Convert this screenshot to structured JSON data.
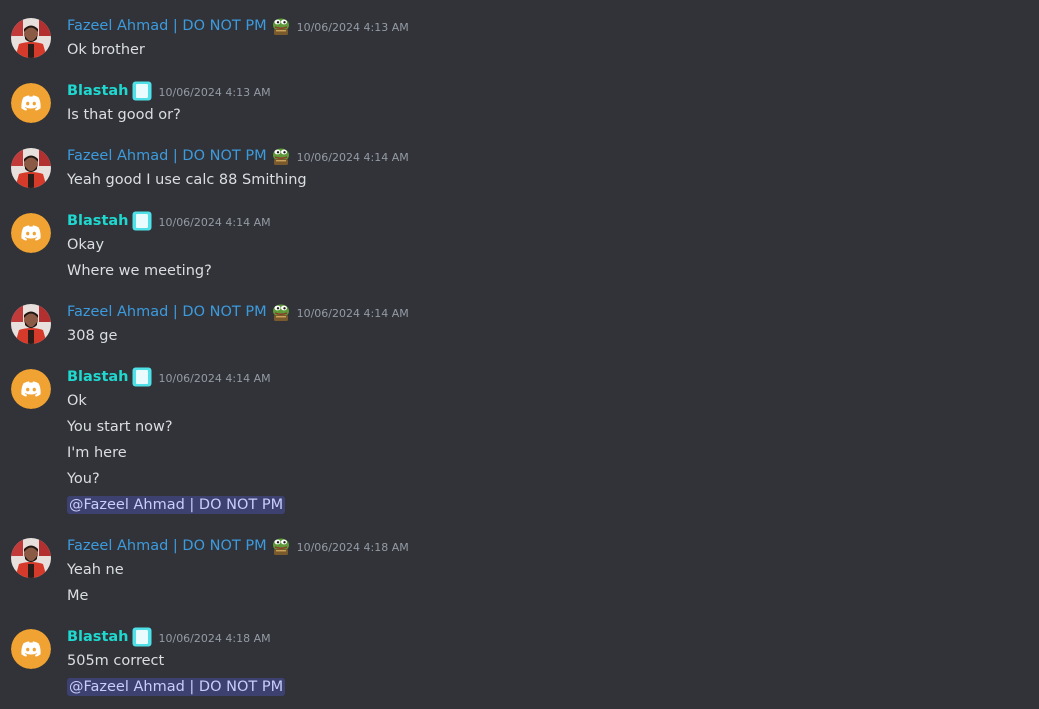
{
  "messages": [
    {
      "user": "Fazeel Ahmad | DO NOT PM",
      "role": "fazeel",
      "badge": "pepe-emoji",
      "time": "10/06/2024 4:13 AM",
      "lines": [
        {
          "text": "Ok brother"
        }
      ]
    },
    {
      "user": "Blastah",
      "role": "blastah",
      "badge": "app-tag",
      "time": "10/06/2024 4:13 AM",
      "lines": [
        {
          "text": "Is that good or?"
        }
      ]
    },
    {
      "user": "Fazeel Ahmad | DO NOT PM",
      "role": "fazeel",
      "badge": "pepe-emoji",
      "time": "10/06/2024 4:14 AM",
      "lines": [
        {
          "text": "Yeah good I use calc 88 Smithing"
        }
      ]
    },
    {
      "user": "Blastah",
      "role": "blastah",
      "badge": "app-tag",
      "time": "10/06/2024 4:14 AM",
      "lines": [
        {
          "text": "Okay"
        },
        {
          "text": "Where we meeting?"
        }
      ]
    },
    {
      "user": "Fazeel Ahmad | DO NOT PM",
      "role": "fazeel",
      "badge": "pepe-emoji",
      "time": "10/06/2024 4:14 AM",
      "lines": [
        {
          "text": "308 ge"
        }
      ]
    },
    {
      "user": "Blastah",
      "role": "blastah",
      "badge": "app-tag",
      "time": "10/06/2024 4:14 AM",
      "lines": [
        {
          "text": "Ok"
        },
        {
          "text": "You start now?"
        },
        {
          "text": "I'm here"
        },
        {
          "text": "You?"
        },
        {
          "text": "@Fazeel Ahmad | DO NOT PM",
          "mention": true
        }
      ]
    },
    {
      "user": "Fazeel Ahmad | DO NOT PM",
      "role": "fazeel",
      "badge": "pepe-emoji",
      "time": "10/06/2024 4:18 AM",
      "lines": [
        {
          "text": "Yeah ne"
        },
        {
          "text": "Me"
        }
      ]
    },
    {
      "user": "Blastah",
      "role": "blastah",
      "badge": "app-tag",
      "time": "10/06/2024 4:18 AM",
      "lines": [
        {
          "text": "505m correct"
        },
        {
          "text": "@Fazeel Ahmad | DO NOT PM",
          "mention": true
        }
      ]
    }
  ],
  "colors": {
    "background": "#313338",
    "fazeel_name": "#3c9bde",
    "blastah_name": "#1fd8d0",
    "discord_avatar": "#f0a232",
    "mention_bg": "#3e4270"
  }
}
